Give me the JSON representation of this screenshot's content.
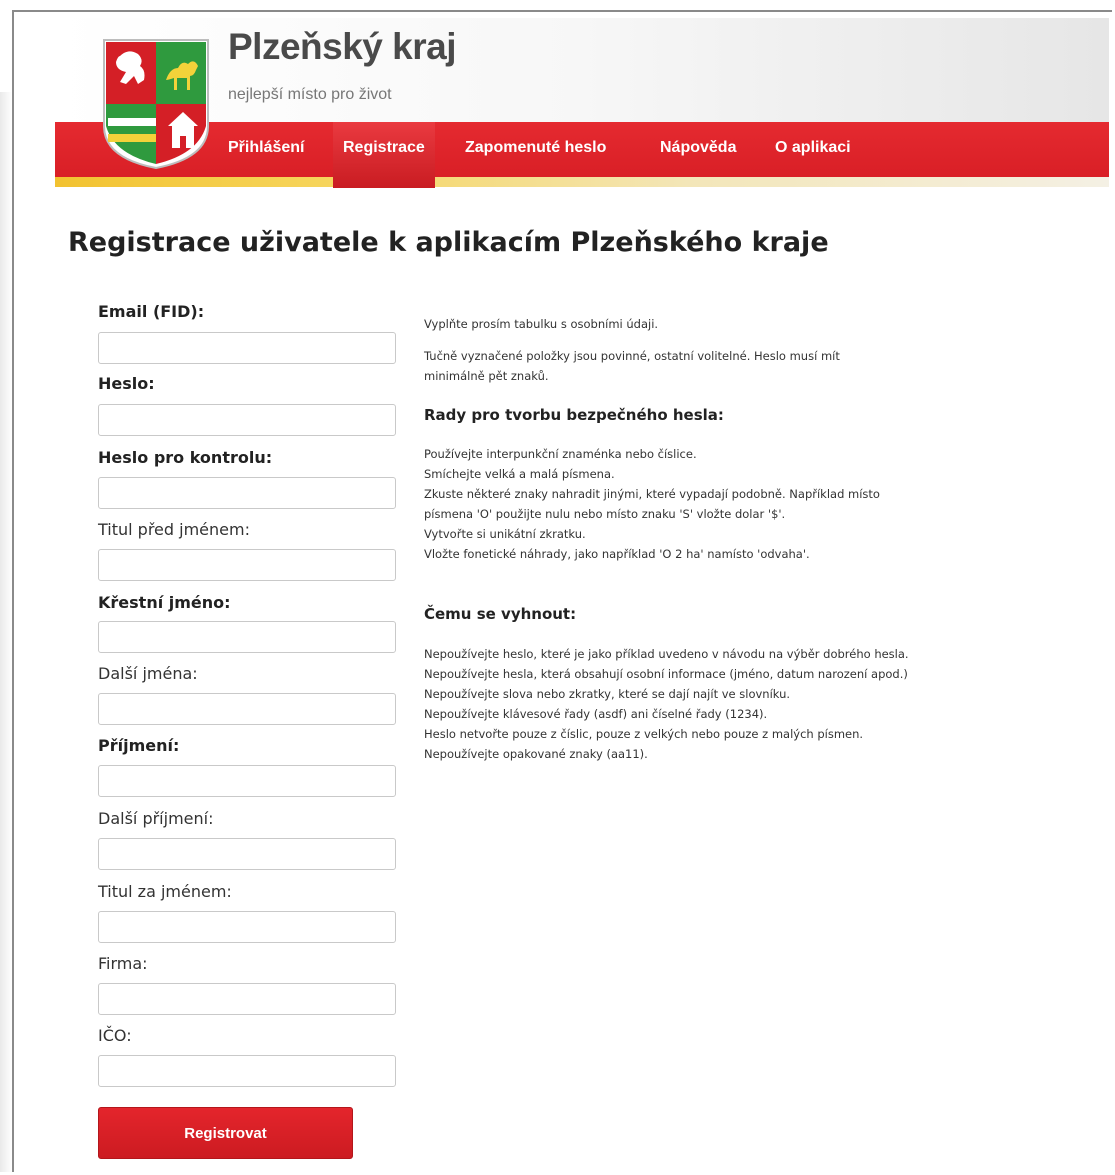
{
  "site": {
    "title": "Plzeňský kraj",
    "subtitle": "nejlepší místo pro život"
  },
  "nav": {
    "items": [
      {
        "label": "Přihlášení",
        "active": false
      },
      {
        "label": "Registrace",
        "active": true
      },
      {
        "label": "Zapomenuté heslo",
        "active": false
      },
      {
        "label": "Nápověda",
        "active": false
      },
      {
        "label": "O aplikaci",
        "active": false
      }
    ]
  },
  "page": {
    "title": "Registrace uživatele k aplikacím Plzeňského kraje"
  },
  "form": {
    "fields": [
      {
        "label": "Email (FID):",
        "required": true,
        "value": ""
      },
      {
        "label": "Heslo:",
        "required": true,
        "value": ""
      },
      {
        "label": "Heslo pro kontrolu:",
        "required": true,
        "value": ""
      },
      {
        "label": "Titul před jménem:",
        "required": false,
        "value": ""
      },
      {
        "label": "Křestní jméno:",
        "required": true,
        "value": ""
      },
      {
        "label": "Další jména:",
        "required": false,
        "value": ""
      },
      {
        "label": "Příjmení:",
        "required": true,
        "value": ""
      },
      {
        "label": "Další příjmení:",
        "required": false,
        "value": ""
      },
      {
        "label": "Titul za jménem:",
        "required": false,
        "value": ""
      },
      {
        "label": "Firma:",
        "required": false,
        "value": ""
      },
      {
        "label": "IČO:",
        "required": false,
        "value": ""
      }
    ],
    "submit_label": "Registrovat"
  },
  "help": {
    "intro": "Vyplňte prosím tabulku s osobními údaji.",
    "required_note": "Tučně vyznačené položky jsou povinné, ostatní volitelné. Heslo musí mít minimálně pět znaků.",
    "tips_heading": "Rady pro tvorbu bezpečného hesla:",
    "tips": [
      "Používejte interpunkční znaménka nebo číslice.",
      "Smíchejte velká a malá písmena.",
      "Zkuste některé znaky nahradit jinými, které vypadají podobně. Například místo písmena 'O' použijte nulu nebo místo znaku 'S' vložte dolar '$'.",
      "Vytvořte si unikátní zkratku.",
      "Vložte fonetické náhrady, jako například 'O 2 ha' namísto 'odvaha'."
    ],
    "avoid_heading": "Čemu se vyhnout:",
    "avoid": [
      "Nepoužívejte heslo, které je jako příklad uvedeno v návodu na výběr dobrého hesla.",
      "Nepoužívejte hesla, která obsahují osobní informace (jméno, datum narození apod.)",
      "Nepoužívejte slova nebo zkratky, které se dají najít ve slovníku.",
      "Nepoužívejte klávesové řady (asdf) ani číselné řady (1234).",
      "Heslo netvořte pouze z číslic, pouze z velkých nebo pouze z malých písmen.",
      "Nepoužívejte opakované znaky (aa11)."
    ]
  },
  "colors": {
    "nav_red": "#d91f26",
    "accent_yellow": "#f2c230",
    "button_red": "#d91f26"
  }
}
